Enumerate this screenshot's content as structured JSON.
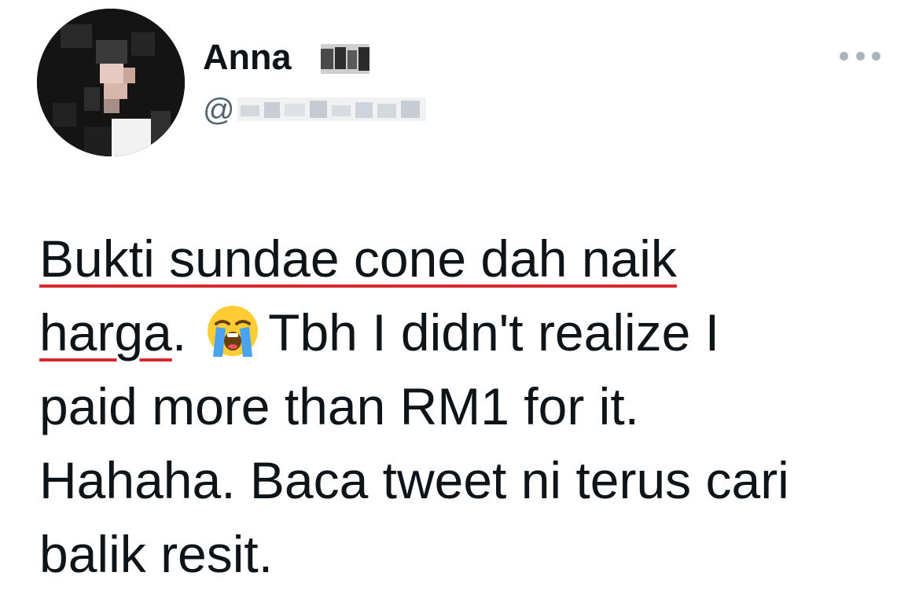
{
  "tweet": {
    "author": {
      "display_name": "Anna",
      "handle_prefix": "@"
    },
    "more_icon": "more-horizontal-icon",
    "emoji_icon": "loudly-crying-face-emoji",
    "text": {
      "line1": "Bukti sundae cone dah naik",
      "line2_underlined": "harga",
      "line2_period": ".",
      "line2_rest": "Tbh I didn't realize I",
      "line3": "paid more than RM1 for it.",
      "line4": "Hahaha. Baca tweet ni terus cari",
      "line5": "balik resit."
    },
    "colors": {
      "text": "#0f1419",
      "secondary": "#536471",
      "underline": "#d8282e",
      "dots": "#aab4bd"
    }
  }
}
